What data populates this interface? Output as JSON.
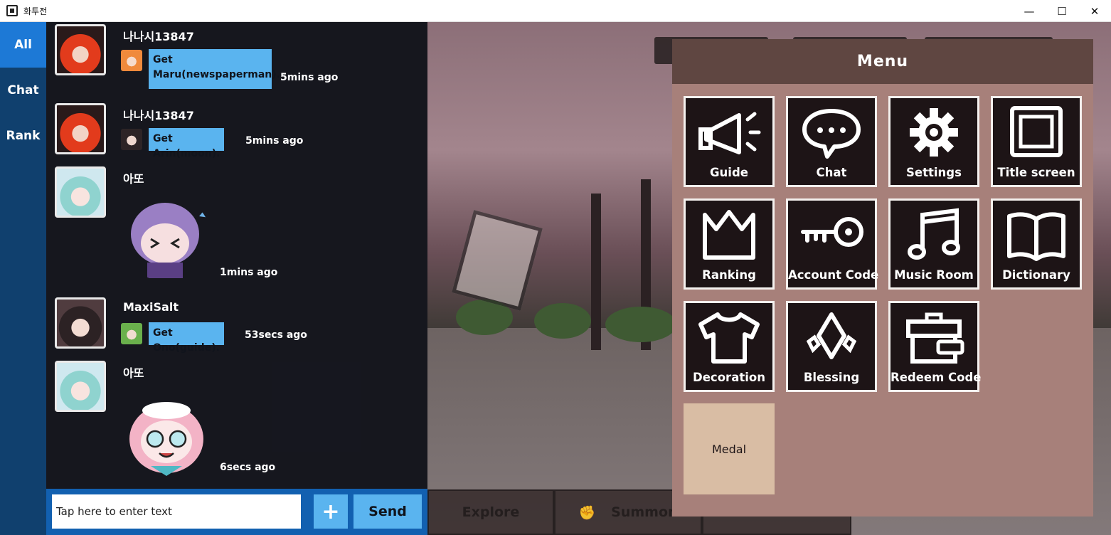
{
  "window": {
    "title": "화투전",
    "minimize_glyph": "—",
    "maximize_glyph": "☐",
    "close_glyph": "✕"
  },
  "side_tabs": [
    {
      "label": "All",
      "active": true
    },
    {
      "label": "Chat",
      "active": false
    },
    {
      "label": "Rank",
      "active": false
    }
  ],
  "messages": [
    {
      "user": "나나시13847",
      "text": "Get\nMaru(newspaperman).",
      "time": "5mins ago"
    },
    {
      "user": "나나시13847",
      "text": "Get Arin(moon).",
      "time": "5mins ago"
    },
    {
      "user": "아또",
      "sticker": "purple-hair-crying-sticker",
      "time": "1mins ago"
    },
    {
      "user": "MaxiSalt",
      "text": "Get Ono(guide).",
      "time": "53secs ago"
    },
    {
      "user": "아또",
      "sticker": "pink-hair-glasses-sticker",
      "time": "6secs ago"
    }
  ],
  "input": {
    "placeholder": "Tap here to enter text",
    "plus_label": "+",
    "send_label": "Send"
  },
  "bottom_nav": {
    "explore": "Explore",
    "summon": "Summon"
  },
  "menu": {
    "title": "Menu",
    "items": [
      {
        "label": "Guide",
        "icon": "megaphone-icon"
      },
      {
        "label": "Chat",
        "icon": "speech-bubble-icon"
      },
      {
        "label": "Settings",
        "icon": "gear-icon"
      },
      {
        "label": "Title screen",
        "icon": "monitor-icon"
      },
      {
        "label": "Ranking",
        "icon": "crown-icon"
      },
      {
        "label": "Account Code",
        "icon": "key-icon"
      },
      {
        "label": "Music Room",
        "icon": "music-note-icon"
      },
      {
        "label": "Dictionary",
        "icon": "book-icon"
      },
      {
        "label": "Decoration",
        "icon": "shirt-icon"
      },
      {
        "label": "Blessing",
        "icon": "diamond-icon"
      },
      {
        "label": "Redeem Code",
        "icon": "gift-box-icon"
      },
      {
        "label": "Medal",
        "icon": ""
      }
    ]
  },
  "colors": {
    "side_tab_active": "#1d79d6",
    "side_tab_bg": "#10406e",
    "bubble": "#5ab4ef",
    "menu_bg": "#a7807a",
    "menu_header": "#5f4641",
    "tile_bg": "#1d1416",
    "medal_tile": "#d9bda4"
  }
}
